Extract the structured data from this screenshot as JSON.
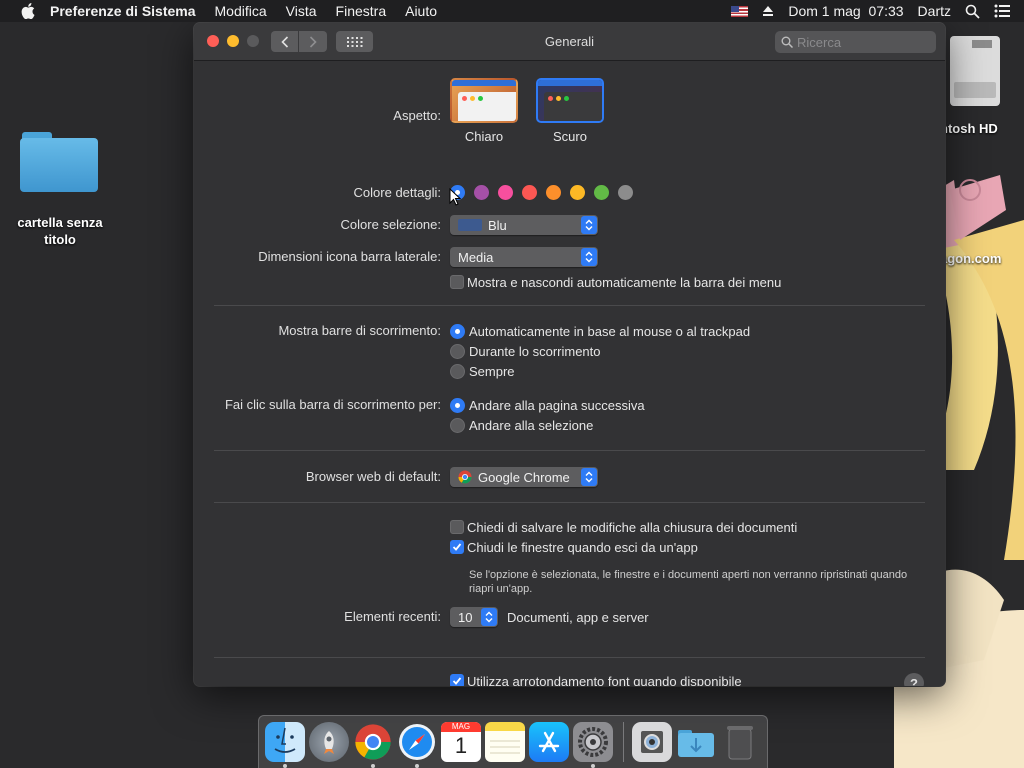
{
  "menubar": {
    "app_name": "Preferenze di Sistema",
    "menus": [
      "Modifica",
      "Vista",
      "Finestra",
      "Aiuto"
    ],
    "date": "Dom 1 mag",
    "time": "07:33",
    "user": "Dartz"
  },
  "desktop": {
    "folder_label": "cartella senza titolo",
    "disk_label": "ntosh HD",
    "site_label": "agon.com"
  },
  "window": {
    "title": "Generali",
    "search_placeholder": "Ricerca",
    "appearance": {
      "label": "Aspetto:",
      "options": [
        "Chiaro",
        "Scuro"
      ],
      "selected": "Scuro"
    },
    "accent": {
      "label": "Colore dettagli:",
      "colors": [
        "#2f7bf5",
        "#a550a7",
        "#f74f9e",
        "#fc5753",
        "#fc8f2b",
        "#fdb925",
        "#62ba46",
        "#8c8c8c"
      ],
      "selected_index": 0
    },
    "highlight": {
      "label": "Colore selezione:",
      "value": "Blu",
      "swatch": "#3d5a8f"
    },
    "sidebar_size": {
      "label": "Dimensioni icona barra laterale:",
      "value": "Media"
    },
    "autohide_menubar": {
      "label": "Mostra e nascondi automaticamente la barra dei menu",
      "checked": false
    },
    "scrollbars": {
      "label": "Mostra barre di scorrimento:",
      "options": [
        "Automaticamente in base al mouse o al trackpad",
        "Durante lo scorrimento",
        "Sempre"
      ],
      "selected_index": 0
    },
    "click_scrollbar": {
      "label": "Fai clic sulla barra di scorrimento per:",
      "options": [
        "Andare alla pagina successiva",
        "Andare alla selezione"
      ],
      "selected_index": 0
    },
    "browser": {
      "label": "Browser web di default:",
      "value": "Google Chrome"
    },
    "ask_save": {
      "label": "Chiedi di salvare le modifiche alla chiusura dei documenti",
      "checked": false
    },
    "close_windows": {
      "label": "Chiudi le finestre quando esci da un'app",
      "checked": true
    },
    "close_windows_note": "Se l'opzione è selezionata, le finestre e i documenti aperti non verranno ripristinati quando riapri un'app.",
    "recent": {
      "label": "Elementi recenti:",
      "value": "10",
      "suffix": "Documenti, app e server"
    },
    "font_smoothing": {
      "label": "Utilizza arrotondamento font quando disponibile",
      "checked": true
    },
    "help": "?"
  },
  "dock": {
    "apps": [
      "finder-icon",
      "launchpad-icon",
      "chrome-icon",
      "safari-icon",
      "calendar-icon",
      "notes-icon",
      "app-store-icon",
      "system-preferences-icon",
      "preview-icon",
      "downloads-folder-icon",
      "trash-icon"
    ],
    "calendar_month": "MAG",
    "calendar_day": "1"
  }
}
